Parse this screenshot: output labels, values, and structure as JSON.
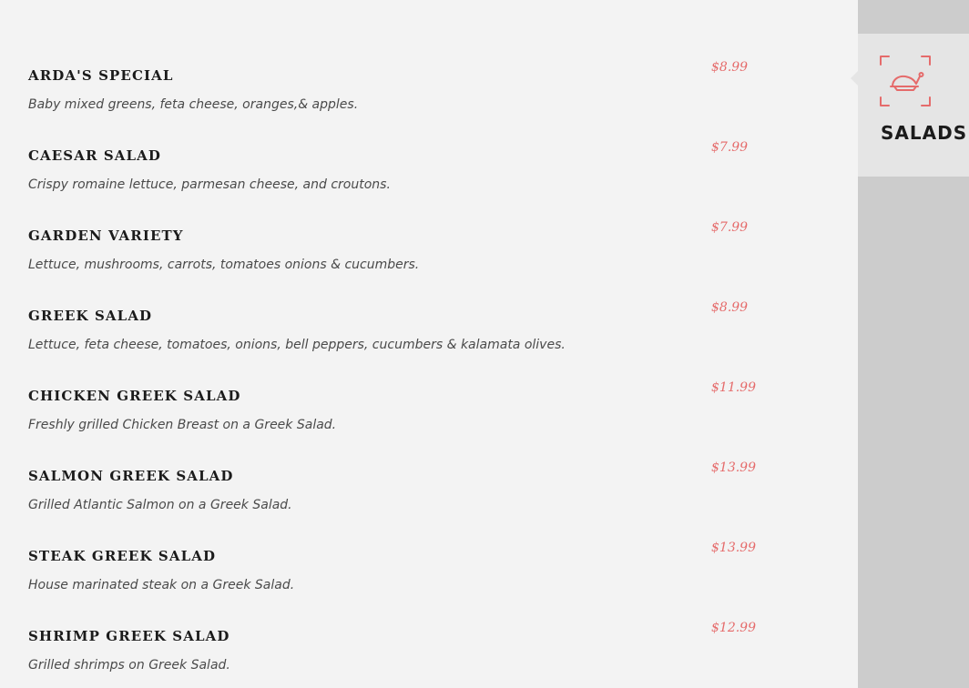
{
  "menu": {
    "items": [
      {
        "name": "ARDA'S SPECIAL",
        "description": "Baby mixed greens, feta cheese, oranges,& apples.",
        "price": "$8.99"
      },
      {
        "name": "CAESAR SALAD",
        "description": "Crispy romaine lettuce, parmesan cheese, and croutons.",
        "price": "$7.99"
      },
      {
        "name": "GARDEN VARIETY",
        "description": "Lettuce, mushrooms, carrots, tomatoes onions & cucumbers.",
        "price": "$7.99"
      },
      {
        "name": "GREEK SALAD",
        "description": "Lettuce, feta cheese, tomatoes, onions, bell peppers, cucumbers & kalamata olives.",
        "price": "$8.99"
      },
      {
        "name": "CHICKEN GREEK SALAD",
        "description": "Freshly grilled Chicken Breast on a Greek Salad.",
        "price": "$11.99"
      },
      {
        "name": "SALMON GREEK SALAD",
        "description": "Grilled Atlantic Salmon on a Greek Salad.",
        "price": "$13.99"
      },
      {
        "name": "STEAK GREEK SALAD",
        "description": "House marinated steak on a Greek Salad.",
        "price": "$13.99"
      },
      {
        "name": "SHRIMP GREEK SALAD",
        "description": "Grilled shrimps on Greek Salad.",
        "price": "$12.99"
      }
    ]
  },
  "sidebar": {
    "active_tab": {
      "label": "SALADS",
      "icon": "roast-chicken-icon"
    }
  },
  "colors": {
    "accent": "#e56b6b",
    "page_background": "#f3f3f3",
    "sidebar_background": "#cccccc",
    "active_tab_background": "#e5e5e5",
    "text": "#1b1b1b",
    "description_text": "#4a4a4a"
  }
}
